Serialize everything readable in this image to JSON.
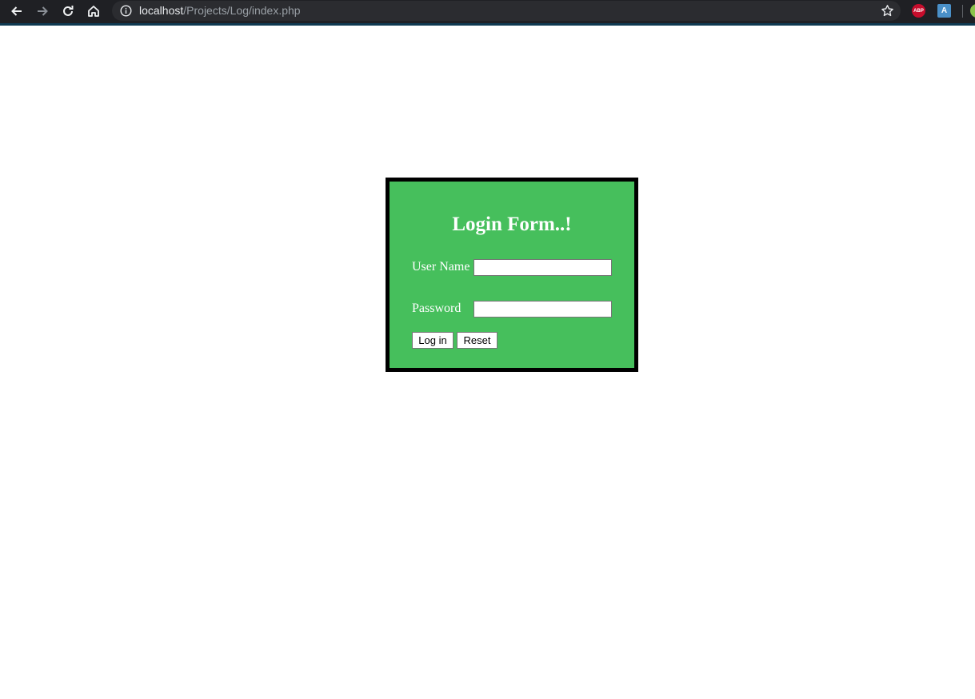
{
  "browser": {
    "url_host": "localhost",
    "url_path": "/Projects/Log/index.php",
    "extensions": [
      "ABP",
      "A"
    ],
    "icons": [
      "back-arrow-icon",
      "forward-arrow-icon",
      "reload-icon",
      "home-icon",
      "info-icon",
      "star-icon"
    ]
  },
  "form": {
    "title": "Login Form..!",
    "username_label": "User Name",
    "username_value": "",
    "password_label": "Password",
    "password_value": "",
    "login_label": "Log in",
    "reset_label": "Reset",
    "background_color": "#46bf5c",
    "border_color": "#000000"
  }
}
